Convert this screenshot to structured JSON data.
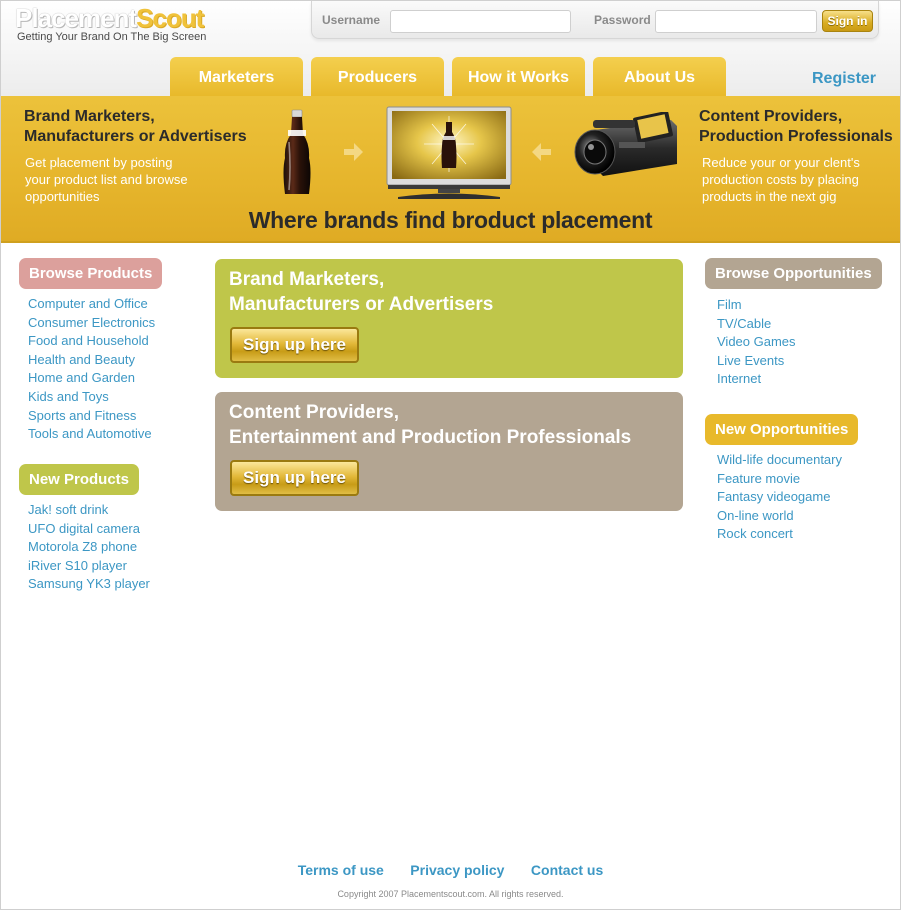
{
  "header": {
    "logo_part1": "Placement",
    "logo_part2": "Scout",
    "tagline": "Getting Your Brand On The Big Screen",
    "username_label": "Username",
    "password_label": "Password",
    "signin_label": "Sign in"
  },
  "nav": {
    "tabs": [
      {
        "label": "Marketers"
      },
      {
        "label": "Producers"
      },
      {
        "label": "How it Works"
      },
      {
        "label": "About Us"
      }
    ],
    "register_label": "Register"
  },
  "banner": {
    "left_heading_line1": "Brand Marketers,",
    "left_heading_line2": "Manufacturers or Advertisers",
    "left_desc_line1": "Get placement by posting",
    "left_desc_line2": "your product list and browse",
    "left_desc_line3": "opportunities",
    "right_heading_line1": "Content Providers,",
    "right_heading_line2": "Production Professionals",
    "right_desc_line1": "Reduce your or your clent's",
    "right_desc_line2": "production costs by placing",
    "right_desc_line3": "products in the next gig",
    "tagline": "Where brands find broduct placement"
  },
  "left": {
    "browse_title": "Browse Products",
    "browse_items": [
      "Computer and Office",
      "Consumer Electronics",
      "Food and Household",
      "Health and Beauty",
      "Home and Garden",
      "Kids and Toys",
      "Sports and Fitness",
      "Tools and Automotive"
    ],
    "new_title": "New Products",
    "new_items": [
      "Jak! soft drink",
      "UFO digital camera",
      "Motorola Z8 phone",
      "iRiver S10 player",
      "Samsung YK3 player"
    ]
  },
  "center": {
    "panel1_line1": "Brand Marketers,",
    "panel1_line2": "Manufacturers or Advertisers",
    "panel1_button": "Sign up here",
    "panel2_line1": "Content Providers,",
    "panel2_line2": "Entertainment and Production Professionals",
    "panel2_button": "Sign up here"
  },
  "right": {
    "browse_title": "Browse Opportunities",
    "browse_items": [
      "Film",
      "TV/Cable",
      "Video Games",
      "Live Events",
      "Internet"
    ],
    "new_title": "New Opportunities",
    "new_items": [
      "Wild-life documentary",
      "Feature movie",
      "Fantasy videogame",
      "On-line world",
      "Rock concert"
    ]
  },
  "footer": {
    "links": [
      "Terms of use",
      "Privacy policy",
      "Contact us"
    ],
    "copyright": "Copyright 2007 Placementscout.com. All rights reserved."
  },
  "colors": {
    "accent_yellow": "#e8b92b",
    "link_blue": "#3c97c4",
    "pink_pill": "#dca09c",
    "green_panel": "#bfc64a",
    "taupe_panel": "#b3a592"
  }
}
